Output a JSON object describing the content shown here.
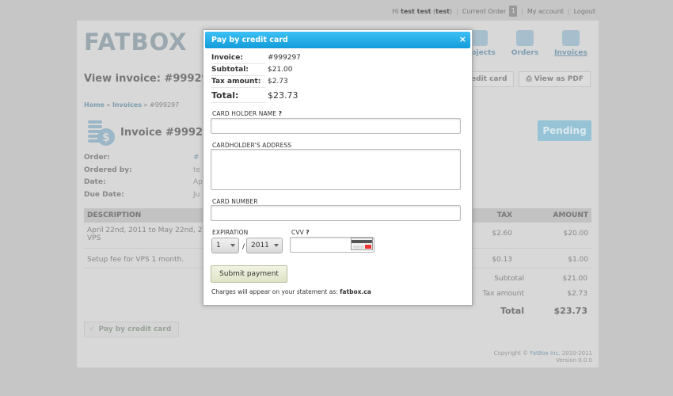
{
  "topbar": {
    "greeting": "Hi",
    "user_name": "test test",
    "user_id": "test",
    "current_order_label": "Current Order",
    "current_order_count": "1",
    "my_account_label": "My account",
    "logout_label": "Logout"
  },
  "brand": {
    "logo_text_a": "FATB",
    "logo_text_b": "OX"
  },
  "nav": [
    {
      "label": "Projects",
      "icon": "projects-icon"
    },
    {
      "label": "Orders",
      "icon": "orders-icon"
    },
    {
      "label": "Invoices",
      "icon": "invoices-icon"
    }
  ],
  "page": {
    "title": "View invoice: #999297",
    "actions": {
      "pay_label": "Pay by credit card",
      "pdf_label": "View as PDF"
    },
    "breadcrumb": {
      "home": "Home",
      "invoices": "Invoices",
      "current": "#999297"
    },
    "invoice_heading": "Invoice #999297",
    "status": "Pending",
    "meta": [
      {
        "key": "Order:",
        "value": "#",
        "link": true
      },
      {
        "key": "Ordered by:",
        "value": "te",
        "link": false
      },
      {
        "key": "Date:",
        "value": "Ap",
        "link": false
      },
      {
        "key": "Due Date:",
        "value": "Ju",
        "link": false
      }
    ],
    "table": {
      "headers": {
        "description": "DESCRIPTION",
        "tax": "TAX",
        "amount": "AMOUNT"
      },
      "rows": [
        {
          "description_line1": "April 22nd, 2011 to May 22nd, 20",
          "description_line2": "VPS",
          "tax": "$2.60",
          "amount": "$20.00"
        },
        {
          "description_line1": "Setup fee for VPS 1 month.",
          "description_line2": "",
          "tax": "$0.13",
          "amount": "$1.00"
        }
      ]
    },
    "totals": {
      "subtotal_label": "Subtotal",
      "subtotal": "$21.00",
      "tax_label": "Tax amount",
      "tax": "$2.73",
      "total_label": "Total",
      "total": "$23.73"
    },
    "pay_button_label": "Pay by credit card",
    "footer": {
      "copyright_prefix": "Copyright ©",
      "company": "FatBox Inc.",
      "years": "2010-2011",
      "version": "Version 0.0.0"
    }
  },
  "modal": {
    "title": "Pay by credit card",
    "close_glyph": "×",
    "summary": {
      "invoice_label": "Invoice:",
      "invoice_value": "#999297",
      "subtotal_label": "Subtotal:",
      "subtotal_value": "$21.00",
      "tax_label": "Tax amount:",
      "tax_value": "$2.73",
      "total_label": "Total:",
      "total_value": "$23.73"
    },
    "fields": {
      "holder_name_label": "CARD HOLDER NAME",
      "holder_address_label": "CARDHOLDER'S ADDRESS",
      "card_number_label": "CARD NUMBER",
      "expiration_label": "EXPIRATION",
      "cvv_label": "CVV",
      "help_glyph": "?",
      "exp_month": "1",
      "exp_year": "2011",
      "exp_separator": "/"
    },
    "submit_label": "Submit payment",
    "statement_note": "Charges will appear on your statement as:",
    "statement_name": "fatbox.ca"
  },
  "colors": {
    "titlebar_top": "#3dc0f5",
    "titlebar_bottom": "#139cda",
    "pending_badge": "#96c3d6",
    "link": "#7d9db0"
  }
}
